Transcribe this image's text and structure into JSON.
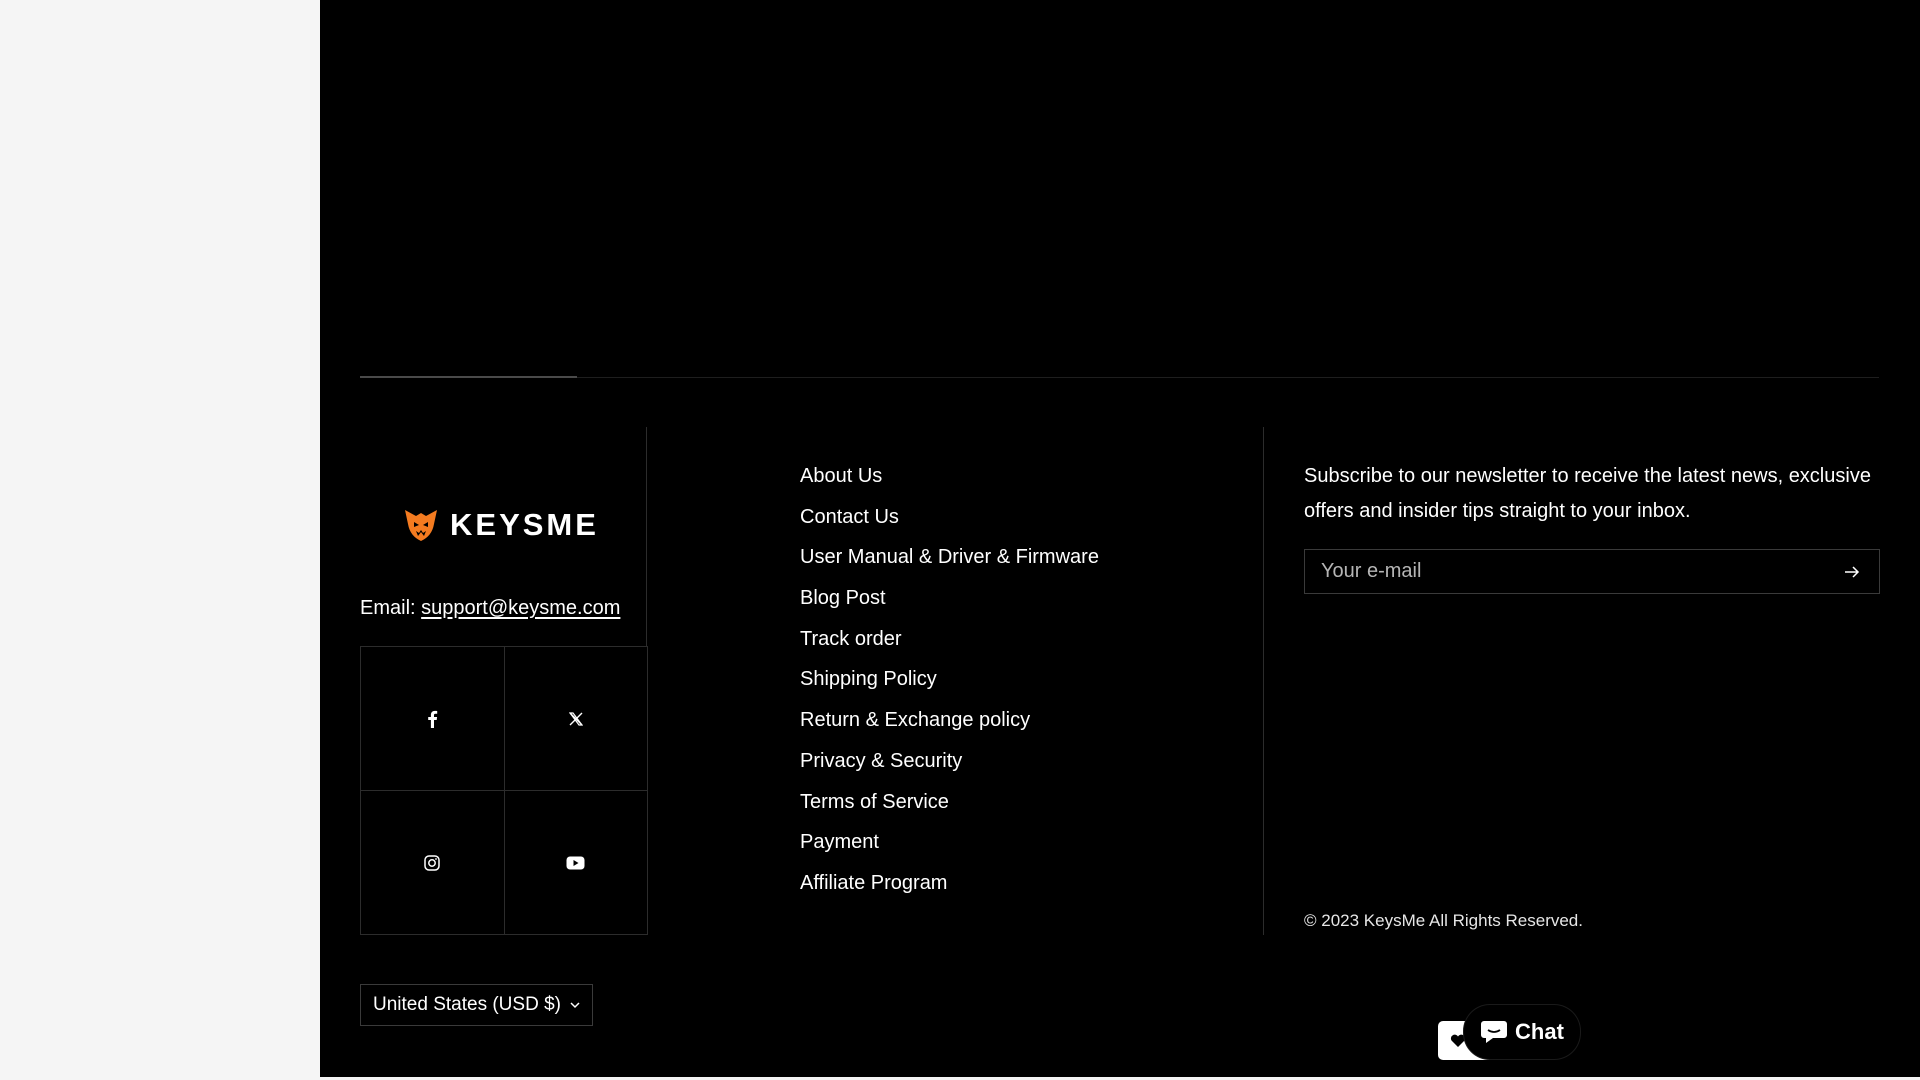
{
  "brand": {
    "name": "KEYSME",
    "accent_color": "#f47b20"
  },
  "contact": {
    "email_label": "Email:",
    "email_address": "support@keysme.com"
  },
  "social": [
    {
      "name": "facebook-icon"
    },
    {
      "name": "x-twitter-icon"
    },
    {
      "name": "instagram-icon"
    },
    {
      "name": "youtube-icon"
    }
  ],
  "footer_links": [
    "About Us",
    "Contact Us",
    "User Manual & Driver & Firmware",
    "Blog Post",
    "Track order",
    "Shipping Policy",
    "Return & Exchange policy",
    "Privacy & Security",
    "Terms of Service",
    "Payment",
    "Affiliate Program"
  ],
  "newsletter": {
    "text": "Subscribe to our newsletter to receive the latest news, exclusive offers and insider tips straight to your inbox.",
    "email_placeholder": "Your e-mail",
    "submit_icon": "arrow-right-icon"
  },
  "copyright": "© 2023 KeysMe All Rights Reserved.",
  "currency": {
    "selected": "United States (USD $)",
    "icon": "chevron-down-icon"
  },
  "chat": {
    "label": "Chat",
    "icon": "chat-bubble-icon"
  },
  "colors": {
    "footer_bg": "#000000",
    "page_bg": "#f5f5f5",
    "border": "#2c2c2c"
  }
}
